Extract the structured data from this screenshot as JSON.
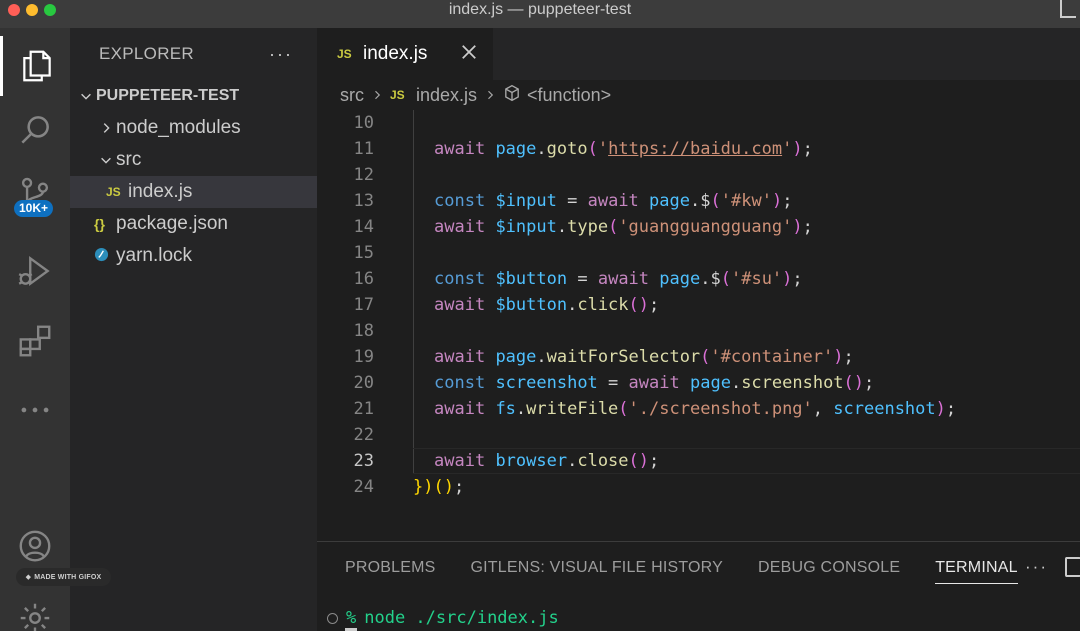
{
  "window": {
    "title": "index.js — puppeteer-test"
  },
  "activity_bar": {
    "items": [
      "explorer-icon",
      "search-icon",
      "source-control-icon",
      "run-debug-icon",
      "extensions-icon",
      "more-icon",
      "accounts-icon",
      "settings-icon"
    ],
    "source_control_badge": "10K+",
    "watermark": "MADE WITH GIFOX"
  },
  "sidebar": {
    "title": "EXPLORER",
    "more": "···",
    "root": "PUPPETEER-TEST",
    "tree": [
      {
        "label": "node_modules",
        "kind": "folder",
        "expanded": false
      },
      {
        "label": "src",
        "kind": "folder",
        "expanded": true
      },
      {
        "label": "index.js",
        "kind": "js",
        "icon_text": "JS",
        "selected": true
      },
      {
        "label": "package.json",
        "kind": "json",
        "icon_text": "{}"
      },
      {
        "label": "yarn.lock",
        "kind": "yarn"
      }
    ]
  },
  "editor": {
    "tab": {
      "label": "index.js",
      "icon_text": "JS"
    },
    "breadcrumb": {
      "folder": "src",
      "file": "index.js",
      "file_icon": "JS",
      "symbol": "<function>"
    },
    "current_line": 23,
    "lines": [
      {
        "n": "10",
        "text": ""
      },
      {
        "n": "11",
        "text": "await page.goto('https://baidu.com');"
      },
      {
        "n": "12",
        "text": ""
      },
      {
        "n": "13",
        "text": "const $input = await page.$('#kw');"
      },
      {
        "n": "14",
        "text": "await $input.type('guangguangguang');"
      },
      {
        "n": "15",
        "text": ""
      },
      {
        "n": "16",
        "text": "const $button = await page.$('#su');"
      },
      {
        "n": "17",
        "text": "await $button.click();"
      },
      {
        "n": "18",
        "text": ""
      },
      {
        "n": "19",
        "text": "await page.waitForSelector('#container');"
      },
      {
        "n": "20",
        "text": "const screenshot = await page.screenshot();"
      },
      {
        "n": "21",
        "text": "await fs.writeFile('./screenshot.png', screenshot);"
      },
      {
        "n": "22",
        "text": ""
      },
      {
        "n": "23",
        "text": "await browser.close();"
      },
      {
        "n": "24",
        "text": "})();"
      }
    ]
  },
  "panel": {
    "tabs": [
      "PROBLEMS",
      "GITLENS: VISUAL FILE HISTORY",
      "DEBUG CONSOLE",
      "TERMINAL"
    ],
    "active_tab": "TERMINAL",
    "more": "···",
    "terminal": {
      "prompt": "%",
      "command": "node ./src/index.js"
    }
  },
  "colors": {
    "keyword": "#c586c0",
    "storage": "#569cd6",
    "variable": "#4fc1ff",
    "function": "#dcdcaa",
    "string": "#ce9178",
    "bracket1": "#ffd700",
    "bracket2": "#da70d6",
    "bracket3": "#179fff",
    "accent_badge": "#0e70c0",
    "terminal_prompt": "#23d18b"
  }
}
